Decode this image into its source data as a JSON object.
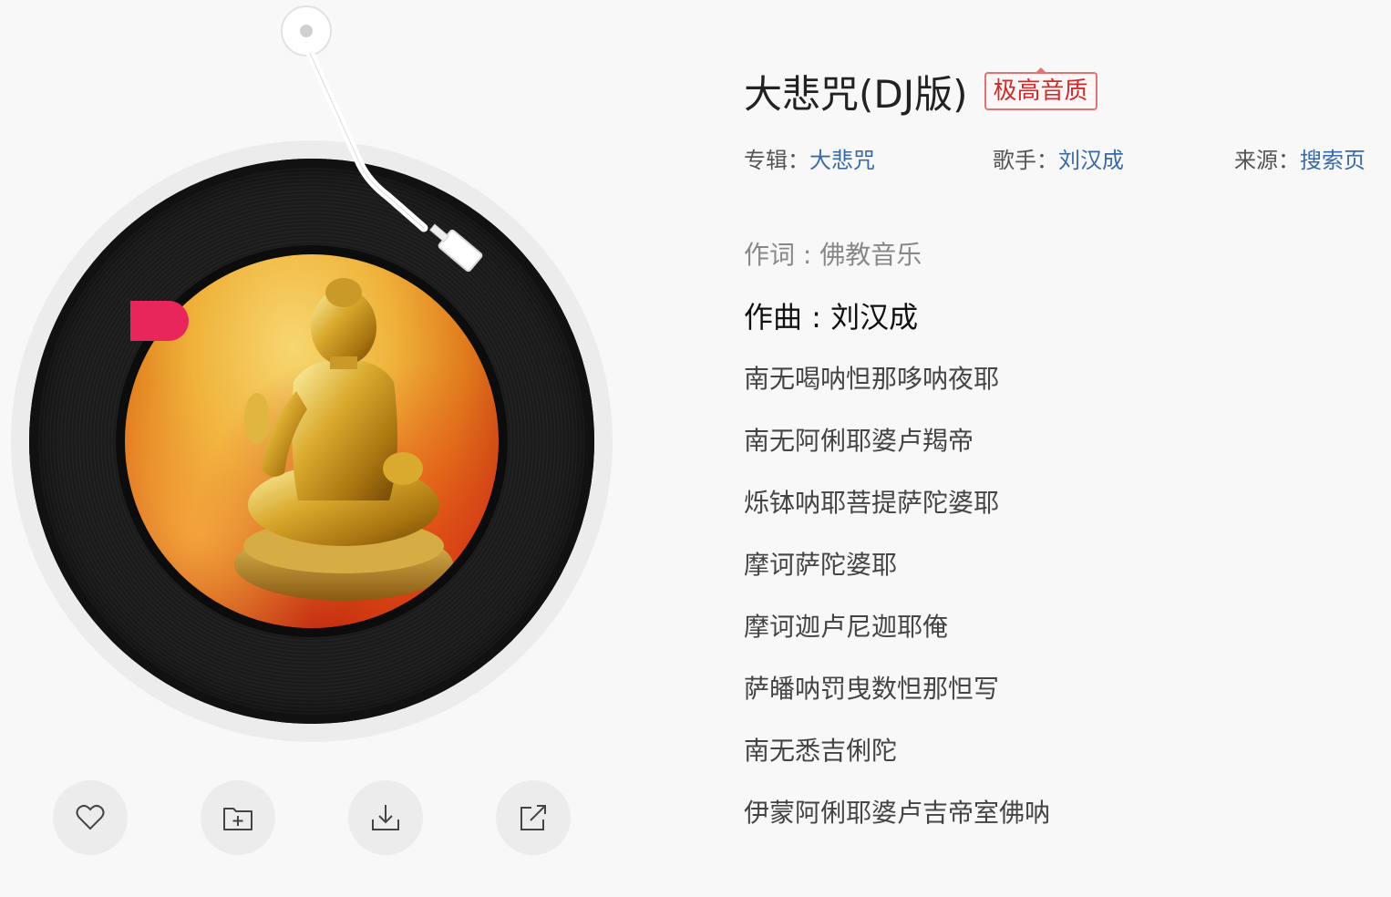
{
  "song": {
    "title": "大悲咒(DJ版)",
    "quality_badge": "极高音质"
  },
  "meta": {
    "album_label": "专辑：",
    "album_value": "大悲咒",
    "artist_label": "歌手：",
    "artist_value": "刘汉成",
    "source_label": "来源：",
    "source_value": "搜索页"
  },
  "lyrics": [
    "作词 : 佛教音乐",
    "作曲 : 刘汉成",
    "南无喝呐怛那哆呐夜耶",
    "南无阿俐耶婆卢羯帝",
    "烁钵呐耶菩提萨陀婆耶",
    "摩诃萨陀婆耶",
    "摩诃迦卢尼迦耶俺",
    "萨皤呐罚曳数怛那怛写",
    "南无悉吉俐陀",
    "伊蒙阿俐耶婆卢吉帝室佛呐"
  ],
  "actions": {
    "like_icon": "heart-icon",
    "add_icon": "folder-add-icon",
    "download_icon": "download-icon",
    "share_icon": "share-icon"
  },
  "colors": {
    "link": "#3a69a8",
    "badge_red": "#d12b2b",
    "accent_pink": "#e8265b"
  }
}
